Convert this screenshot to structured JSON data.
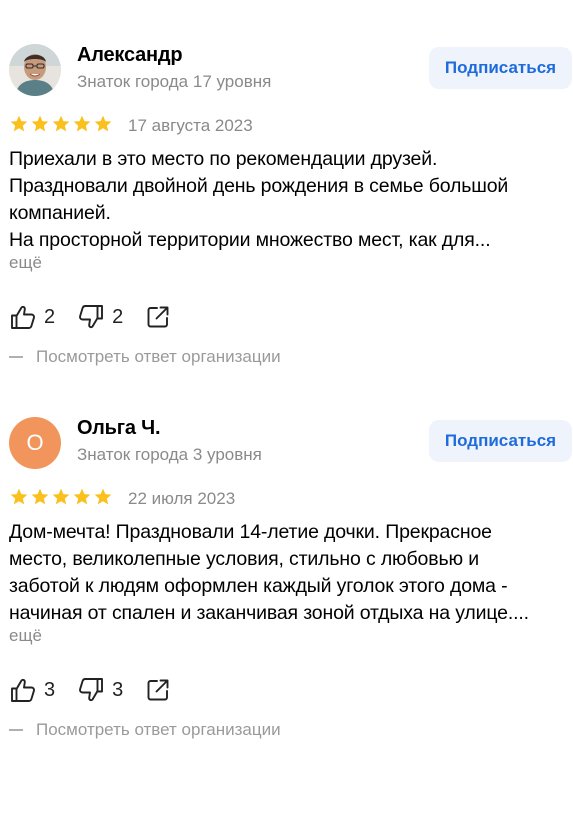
{
  "reviews": [
    {
      "author": "Александр",
      "level": "Знаток города 17 уровня",
      "avatar_letter": "",
      "subscribe_label": "Подписаться",
      "rating": 5,
      "date": "17 августа 2023",
      "text_lines": [
        "Приехали в это место по рекомендации друзей.",
        "Праздновали двойной день рождения в семье большой",
        "компанией.",
        "На просторной территории множество мест, как для..."
      ],
      "more_label": "ещё",
      "likes": "2",
      "dislikes": "2",
      "answer_label": "Посмотреть ответ организации"
    },
    {
      "author": "Ольга Ч.",
      "level": "Знаток города 3 уровня",
      "avatar_letter": "О",
      "subscribe_label": "Подписаться",
      "rating": 5,
      "date": "22 июля 2023",
      "text_lines": [
        "Дом-мечта! Праздновали 14-летие дочки. Прекрасное",
        "место, великолепные условия, стильно с любовью и",
        "заботой к людям оформлен каждый уголок этого дома -",
        "начиная от спален и заканчивая зоной отдыха на улице...."
      ],
      "more_label": "ещё",
      "likes": "3",
      "dislikes": "3",
      "answer_label": "Посмотреть ответ организации"
    }
  ],
  "colors": {
    "star": "#fac11e",
    "subscribe_bg": "#eef3fc",
    "subscribe_text": "#1e6bdc",
    "secondary_text": "#8a8a8a",
    "avatar_letter_bg": "#f2955c"
  },
  "icons": {
    "rating": "star-icon",
    "like": "thumbs-up-icon",
    "dislike": "thumbs-down-icon",
    "share": "share-icon"
  }
}
